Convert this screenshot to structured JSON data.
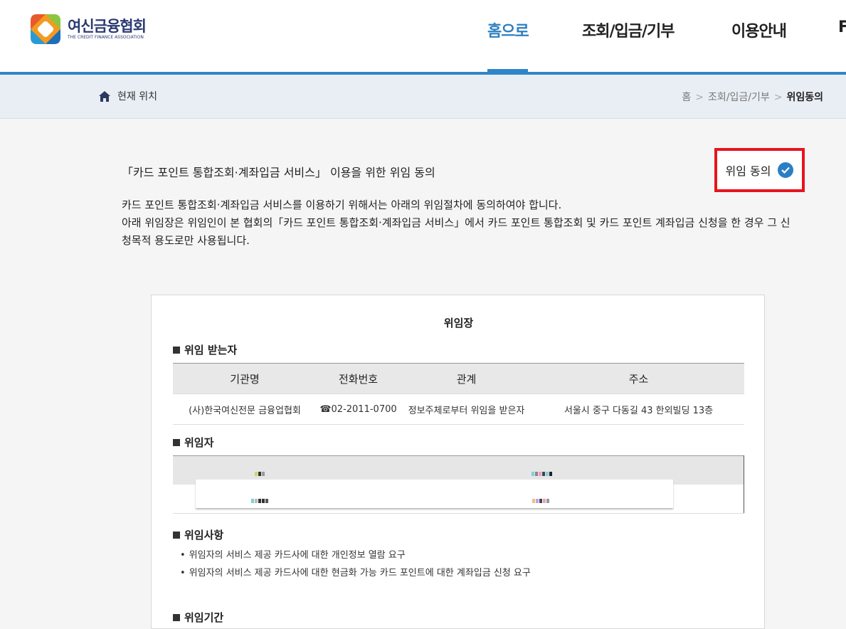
{
  "header": {
    "logo_kr": "여신금융협회",
    "logo_en": "THE CREDIT FINANCE ASSOCIATION",
    "nav": [
      "홈으로",
      "조회/입금/기부",
      "이용안내",
      "F"
    ]
  },
  "breadcrumb": {
    "location_label": "현재 위치",
    "items": [
      "홈",
      "조회/입금/기부"
    ],
    "current": "위임동의",
    "separator": ">"
  },
  "intro": {
    "title": "「카드 포인트 통합조회·계좌입금 서비스」 이용을 위한 위임 동의",
    "agree_button": "위임 동의",
    "desc_line1": "카드 포인트 통합조회·계좌입금 서비스를 이용하기 위해서는 아래의 위임절차에 동의하여야 합니다.",
    "desc_line2": "아래 위임장은 위임인이 본 협회의「카드 포인트 통합조회·계좌입금 서비스」에서 카드 포인트 통합조회 및 카드 포인트 계좌입금 신청을 한 경우 그 신청목적 용도로만 사용됩니다."
  },
  "mandate": {
    "title": "위임장",
    "receiver_section": "위임 받는자",
    "columns": [
      "기관명",
      "전화번호",
      "관계",
      "주소"
    ],
    "row": [
      "(사)한국여신전문 금융업협회",
      "☎02-2011-0700",
      "정보주체로부터 위임을 받은자",
      "서울시 중구 다동길 43 한외빌딩 13층"
    ],
    "mandator_section": "위임자",
    "items_section": "위임사항",
    "items": [
      "위임자의 서비스 제공 카드사에 대한 개인정보 열람 요구",
      "위임자의 서비스 제공 카드사에 대한 현금화 가능 카드 포인트에 대한 계좌입금 신청 요구"
    ],
    "period_section": "위임기간"
  },
  "colors": {
    "accent": "#2e86c9",
    "highlight_border": "#e8141c",
    "check": "#2a7fc4"
  }
}
